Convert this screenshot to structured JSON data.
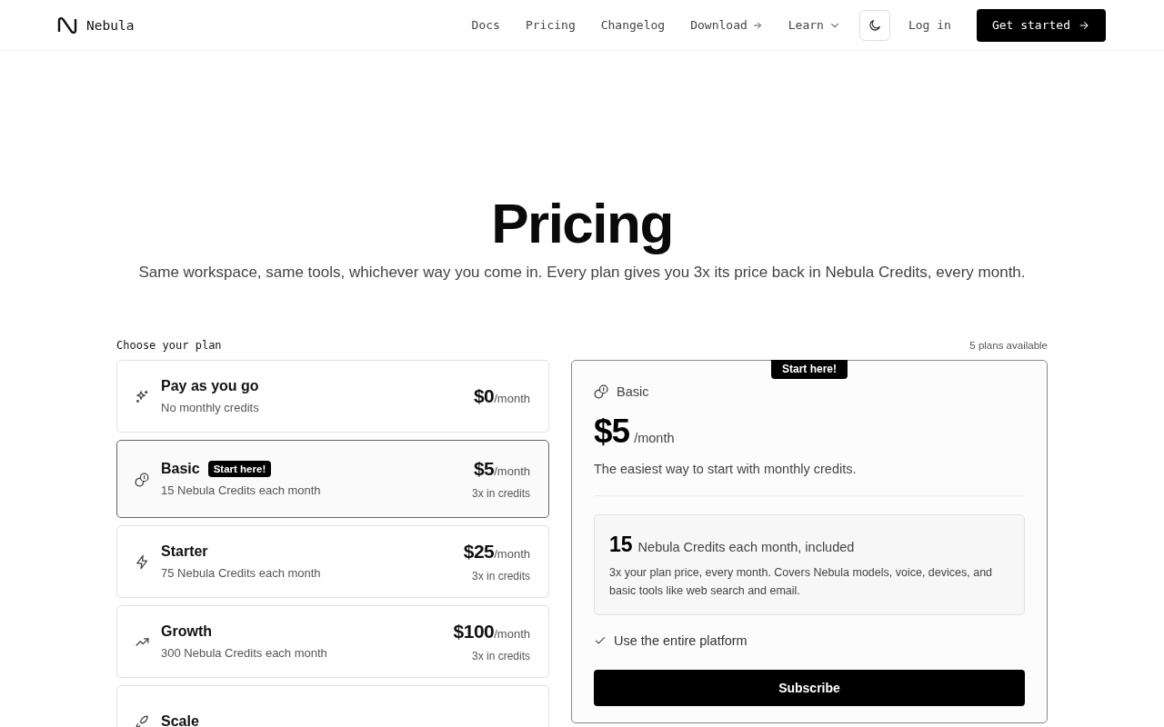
{
  "header": {
    "brand": "Nebula",
    "nav": [
      {
        "label": "Docs",
        "kind": "link"
      },
      {
        "label": "Pricing",
        "kind": "link"
      },
      {
        "label": "Changelog",
        "kind": "link"
      },
      {
        "label": "Download",
        "kind": "external"
      },
      {
        "label": "Learn",
        "kind": "dropdown"
      }
    ],
    "login": "Log in",
    "cta": "Get started"
  },
  "hero": {
    "title": "Pricing",
    "subtitle": "Same workspace, same tools, whichever way you come in. Every plan gives you 3x its price back in Nebula Credits, every month."
  },
  "plans_section": {
    "heading": "Choose your plan",
    "count": "5 plans available",
    "plans": [
      {
        "kind": "sparkles",
        "name": "Pay as you go",
        "subtitle": "No monthly credits",
        "price": "$0",
        "period": "/month",
        "selected": false
      },
      {
        "kind": "coins",
        "name": "Basic",
        "badge": "Start here!",
        "subtitle": "15 Nebula Credits each month",
        "price": "$5",
        "period": "/month",
        "note": "3x in credits",
        "selected": true
      },
      {
        "kind": "zap",
        "name": "Starter",
        "subtitle": "75 Nebula Credits each month",
        "price": "$25",
        "period": "/month",
        "note": "3x in credits",
        "selected": false
      },
      {
        "kind": "trend",
        "name": "Growth",
        "subtitle": "300 Nebula Credits each month",
        "price": "$100",
        "period": "/month",
        "note": "3x in credits",
        "selected": false
      },
      {
        "kind": "rocket",
        "name": "Scale",
        "selected": false
      }
    ]
  },
  "detail": {
    "badge": "Start here!",
    "name": "Basic",
    "price": "$5",
    "period": "/month",
    "description": "The easiest way to start with monthly credits.",
    "credits": {
      "amount": "15",
      "label": "Nebula Credits each month, included",
      "note": "3x your plan price, every month. Covers Nebula models, voice, devices, and basic tools like web search and email."
    },
    "features": [
      "Use the entire platform"
    ],
    "button": "Subscribe"
  }
}
